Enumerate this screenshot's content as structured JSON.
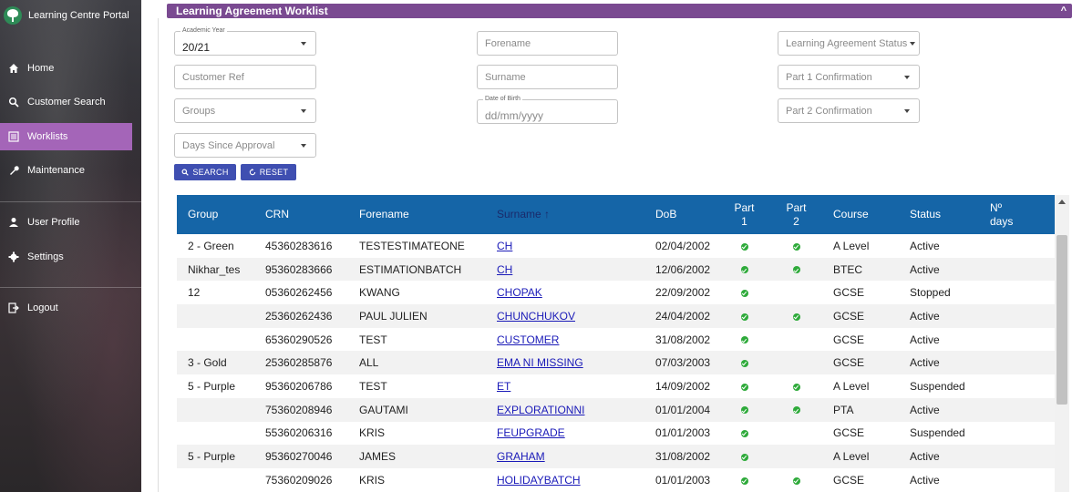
{
  "app": {
    "title": "Learning Centre Portal"
  },
  "nav": [
    {
      "label": "Home",
      "icon": "home-icon"
    },
    {
      "label": "Customer Search",
      "icon": "search-icon"
    },
    {
      "label": "Worklists",
      "icon": "list-icon"
    },
    {
      "label": "Maintenance",
      "icon": "wrench-icon"
    },
    {
      "label": "User Profile",
      "icon": "person-icon"
    },
    {
      "label": "Settings",
      "icon": "gear-icon"
    },
    {
      "label": "Logout",
      "icon": "logout-icon"
    }
  ],
  "panel": {
    "title": "Learning Agreement Worklist",
    "collapse_glyph": "^"
  },
  "filters": {
    "academic_year": {
      "label": "Academic Year",
      "value": "20/21"
    },
    "forename": {
      "placeholder": "Forename"
    },
    "la_status": {
      "placeholder": "Learning Agreement Status"
    },
    "customer_ref": {
      "placeholder": "Customer Ref"
    },
    "surname": {
      "placeholder": "Surname"
    },
    "part1": {
      "placeholder": "Part 1 Confirmation"
    },
    "groups": {
      "placeholder": "Groups"
    },
    "dob": {
      "label": "Date of Birth",
      "placeholder": "dd/mm/yyyy"
    },
    "part2": {
      "placeholder": "Part 2 Confirmation"
    },
    "days_since_approval": {
      "placeholder": "Days Since Approval"
    }
  },
  "buttons": {
    "search": "SEARCH",
    "reset": "RESET"
  },
  "table": {
    "headers": {
      "group": "Group",
      "crn": "CRN",
      "forename": "Forename",
      "surname": "Surname ↑",
      "dob": "DoB",
      "part1_a": "Part",
      "part1_b": "1",
      "part2_a": "Part",
      "part2_b": "2",
      "course": "Course",
      "status": "Status",
      "days_a": "Nº",
      "days_b": "days"
    },
    "rows": [
      {
        "group": "2 - Green",
        "crn": "45360283616",
        "forename": "TESTESTIMATEONE",
        "surname": "CH",
        "dob": "02/04/2002",
        "p1": true,
        "p2": true,
        "course": "A Level",
        "status": "Active"
      },
      {
        "group": "Nikhar_tes",
        "crn": "95360283666",
        "forename": "ESTIMATIONBATCH",
        "surname": "CH",
        "dob": "12/06/2002",
        "p1": true,
        "p2": true,
        "course": "BTEC",
        "status": "Active"
      },
      {
        "group": "12",
        "crn": "05360262456",
        "forename": "KWANG",
        "surname": "CHOPAK",
        "dob": "22/09/2002",
        "p1": true,
        "p2": false,
        "course": "GCSE",
        "status": "Stopped"
      },
      {
        "group": "",
        "crn": "25360262436",
        "forename": "PAUL JULIEN",
        "surname": "CHUNCHUKOV",
        "dob": "24/04/2002",
        "p1": true,
        "p2": true,
        "course": "GCSE",
        "status": "Active"
      },
      {
        "group": "",
        "crn": "65360290526",
        "forename": "TEST",
        "surname": "CUSTOMER",
        "dob": "31/08/2002",
        "p1": true,
        "p2": false,
        "course": "GCSE",
        "status": "Active"
      },
      {
        "group": "3 - Gold",
        "crn": "25360285876",
        "forename": "ALL",
        "surname": "EMA NI MISSING",
        "dob": "07/03/2003",
        "p1": true,
        "p2": false,
        "course": "GCSE",
        "status": "Active"
      },
      {
        "group": "5 - Purple",
        "crn": "95360206786",
        "forename": "TEST",
        "surname": "ET",
        "dob": "14/09/2002",
        "p1": true,
        "p2": true,
        "course": "A Level",
        "status": "Suspended"
      },
      {
        "group": "",
        "crn": "75360208946",
        "forename": "GAUTAMI",
        "surname": "EXPLORATIONNI",
        "dob": "01/01/2004",
        "p1": true,
        "p2": true,
        "course": "PTA",
        "status": "Active"
      },
      {
        "group": "",
        "crn": "55360206316",
        "forename": "KRIS",
        "surname": "FEUPGRADE",
        "dob": "01/01/2003",
        "p1": true,
        "p2": false,
        "course": "GCSE",
        "status": "Suspended"
      },
      {
        "group": "5 - Purple",
        "crn": "95360270046",
        "forename": "JAMES",
        "surname": "GRAHAM",
        "dob": "31/08/2002",
        "p1": true,
        "p2": false,
        "course": "A Level",
        "status": "Active"
      },
      {
        "group": "",
        "crn": "75360209026",
        "forename": "KRIS",
        "surname": "HOLIDAYBATCH",
        "dob": "01/01/2003",
        "p1": true,
        "p2": true,
        "course": "GCSE",
        "status": "Active"
      }
    ]
  },
  "colors": {
    "accent": "#a465b8",
    "panel_header": "#7a4a91",
    "table_header": "#1565a7",
    "button": "#3f4fb1",
    "tick": "#2eaa3a"
  }
}
